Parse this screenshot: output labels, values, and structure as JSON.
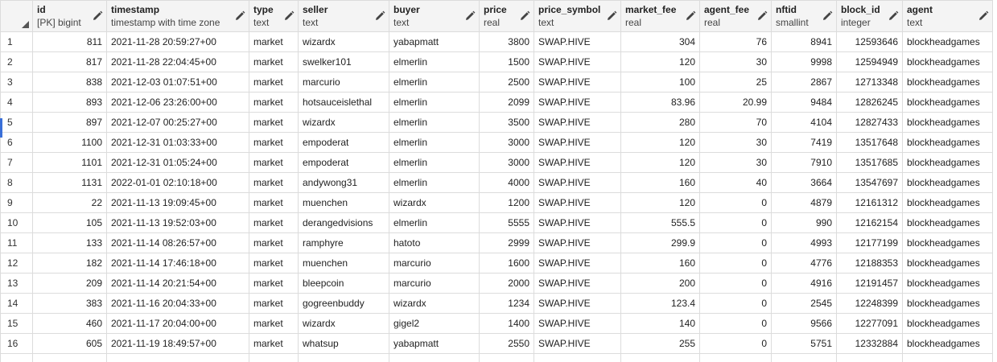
{
  "columns": [
    {
      "key": "id",
      "name": "id",
      "type": "[PK] bigint",
      "align": "num"
    },
    {
      "key": "timestamp",
      "name": "timestamp",
      "type": "timestamp with time zone",
      "align": "txt"
    },
    {
      "key": "type",
      "name": "type",
      "type": "text",
      "align": "txt"
    },
    {
      "key": "seller",
      "name": "seller",
      "type": "text",
      "align": "txt"
    },
    {
      "key": "buyer",
      "name": "buyer",
      "type": "text",
      "align": "txt"
    },
    {
      "key": "price",
      "name": "price",
      "type": "real",
      "align": "num"
    },
    {
      "key": "price_symbol",
      "name": "price_symbol",
      "type": "text",
      "align": "txt"
    },
    {
      "key": "market_fee",
      "name": "market_fee",
      "type": "real",
      "align": "num"
    },
    {
      "key": "agent_fee",
      "name": "agent_fee",
      "type": "real",
      "align": "num"
    },
    {
      "key": "nftid",
      "name": "nftid",
      "type": "smallint",
      "align": "num"
    },
    {
      "key": "block_id",
      "name": "block_id",
      "type": "integer",
      "align": "num"
    },
    {
      "key": "agent",
      "name": "agent",
      "type": "text",
      "align": "txt"
    }
  ],
  "rows": [
    [
      "1",
      "811",
      "2021-11-28 20:59:27+00",
      "market",
      "wizardx",
      "yabapmatt",
      "3800",
      "SWAP.HIVE",
      "304",
      "76",
      "8941",
      "12593646",
      "blockheadgames"
    ],
    [
      "2",
      "817",
      "2021-11-28 22:04:45+00",
      "market",
      "swelker101",
      "elmerlin",
      "1500",
      "SWAP.HIVE",
      "120",
      "30",
      "9998",
      "12594949",
      "blockheadgames"
    ],
    [
      "3",
      "838",
      "2021-12-03 01:07:51+00",
      "market",
      "marcurio",
      "elmerlin",
      "2500",
      "SWAP.HIVE",
      "100",
      "25",
      "2867",
      "12713348",
      "blockheadgames"
    ],
    [
      "4",
      "893",
      "2021-12-06 23:26:00+00",
      "market",
      "hotsauceislethal",
      "elmerlin",
      "2099",
      "SWAP.HIVE",
      "83.96",
      "20.99",
      "9484",
      "12826245",
      "blockheadgames"
    ],
    [
      "5",
      "897",
      "2021-12-07 00:25:27+00",
      "market",
      "wizardx",
      "elmerlin",
      "3500",
      "SWAP.HIVE",
      "280",
      "70",
      "4104",
      "12827433",
      "blockheadgames"
    ],
    [
      "6",
      "1100",
      "2021-12-31 01:03:33+00",
      "market",
      "empoderat",
      "elmerlin",
      "3000",
      "SWAP.HIVE",
      "120",
      "30",
      "7419",
      "13517648",
      "blockheadgames"
    ],
    [
      "7",
      "1101",
      "2021-12-31 01:05:24+00",
      "market",
      "empoderat",
      "elmerlin",
      "3000",
      "SWAP.HIVE",
      "120",
      "30",
      "7910",
      "13517685",
      "blockheadgames"
    ],
    [
      "8",
      "1131",
      "2022-01-01 02:10:18+00",
      "market",
      "andywong31",
      "elmerlin",
      "4000",
      "SWAP.HIVE",
      "160",
      "40",
      "3664",
      "13547697",
      "blockheadgames"
    ],
    [
      "9",
      "22",
      "2021-11-13 19:09:45+00",
      "market",
      "muenchen",
      "wizardx",
      "1200",
      "SWAP.HIVE",
      "120",
      "0",
      "4879",
      "12161312",
      "blockheadgames"
    ],
    [
      "10",
      "105",
      "2021-11-13 19:52:03+00",
      "market",
      "derangedvisions",
      "elmerlin",
      "5555",
      "SWAP.HIVE",
      "555.5",
      "0",
      "990",
      "12162154",
      "blockheadgames"
    ],
    [
      "11",
      "133",
      "2021-11-14 08:26:57+00",
      "market",
      "ramphyre",
      "hatoto",
      "2999",
      "SWAP.HIVE",
      "299.9",
      "0",
      "4993",
      "12177199",
      "blockheadgames"
    ],
    [
      "12",
      "182",
      "2021-11-14 17:46:18+00",
      "market",
      "muenchen",
      "marcurio",
      "1600",
      "SWAP.HIVE",
      "160",
      "0",
      "4776",
      "12188353",
      "blockheadgames"
    ],
    [
      "13",
      "209",
      "2021-11-14 20:21:54+00",
      "market",
      "bleepcoin",
      "marcurio",
      "2000",
      "SWAP.HIVE",
      "200",
      "0",
      "4916",
      "12191457",
      "blockheadgames"
    ],
    [
      "14",
      "383",
      "2021-11-16 20:04:33+00",
      "market",
      "gogreenbuddy",
      "wizardx",
      "1234",
      "SWAP.HIVE",
      "123.4",
      "0",
      "2545",
      "12248399",
      "blockheadgames"
    ],
    [
      "15",
      "460",
      "2021-11-17 20:04:00+00",
      "market",
      "wizardx",
      "gigel2",
      "1400",
      "SWAP.HIVE",
      "140",
      "0",
      "9566",
      "12277091",
      "blockheadgames"
    ],
    [
      "16",
      "605",
      "2021-11-19 18:49:57+00",
      "market",
      "whatsup",
      "yabapmatt",
      "2550",
      "SWAP.HIVE",
      "255",
      "0",
      "5751",
      "12332884",
      "blockheadgames"
    ],
    [
      "",
      "",
      "",
      "",
      "",
      "",
      "",
      "",
      "",
      "",
      "",
      "",
      ""
    ]
  ]
}
